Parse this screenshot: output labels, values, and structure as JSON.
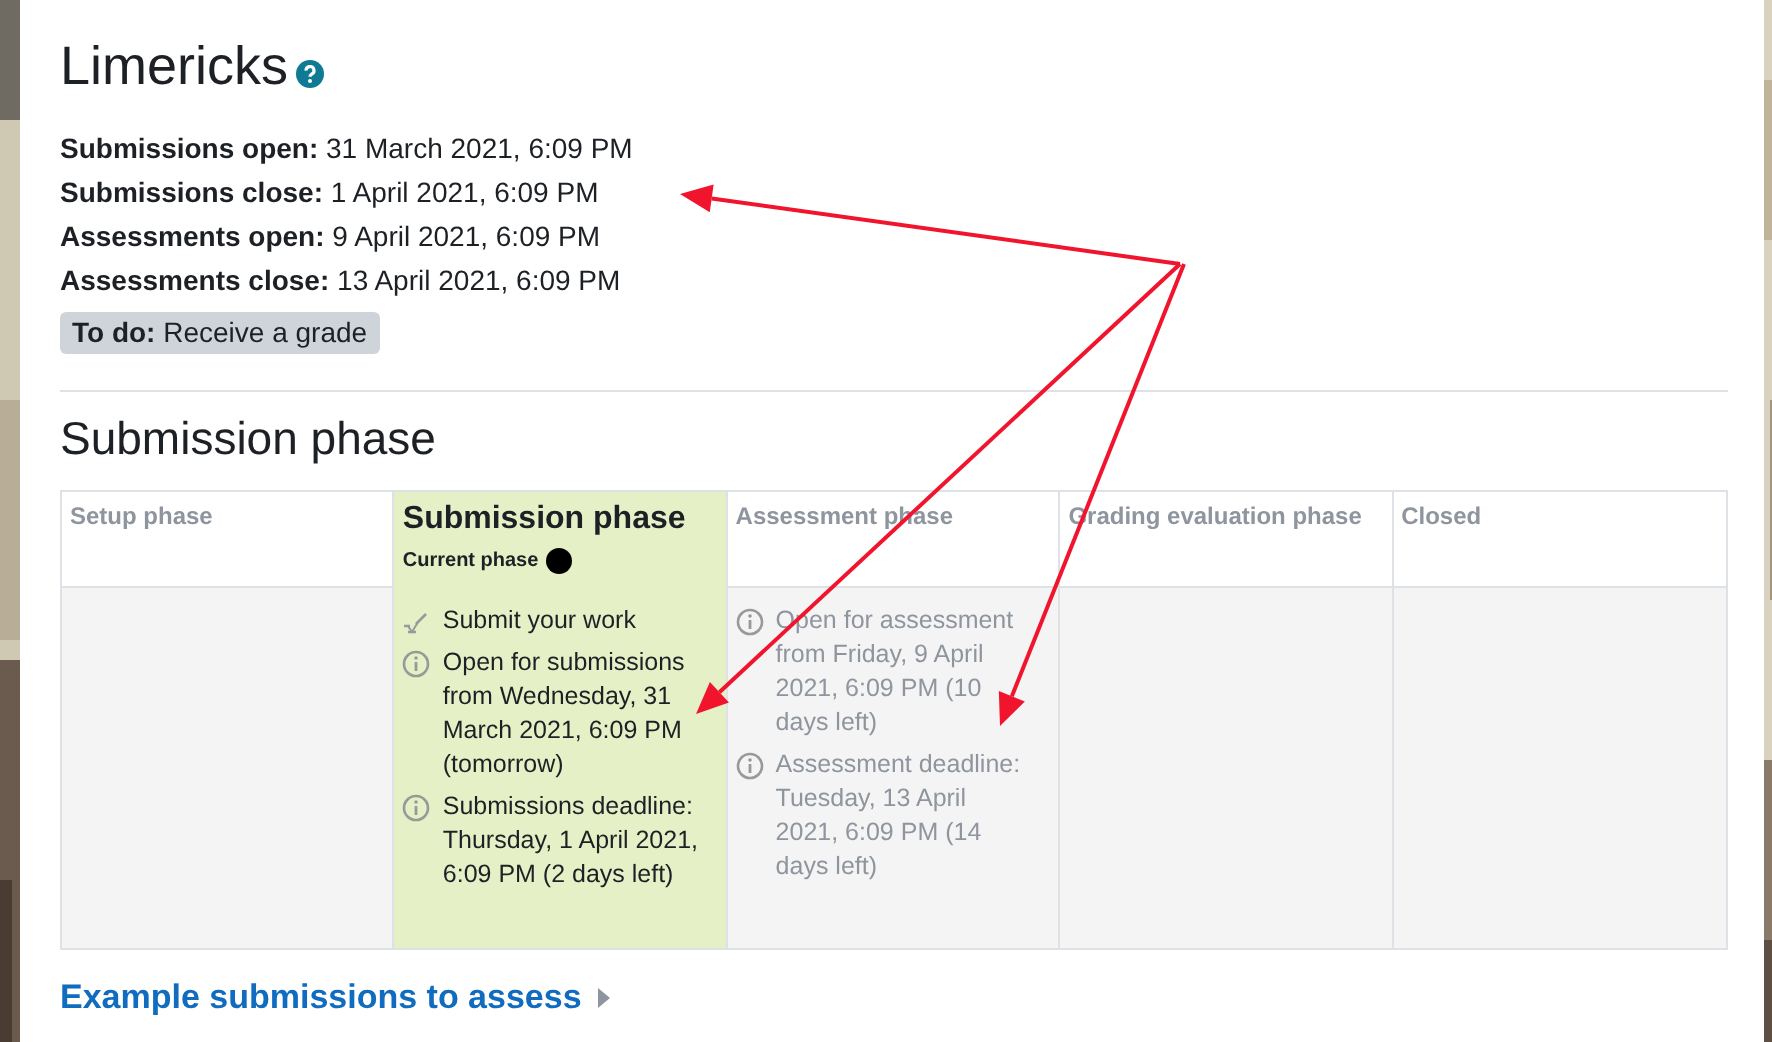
{
  "title": "Limericks",
  "dates": [
    {
      "label": "Submissions open:",
      "value": "31 March 2021, 6:09 PM"
    },
    {
      "label": "Submissions close:",
      "value": "1 April 2021, 6:09 PM"
    },
    {
      "label": "Assessments open:",
      "value": "9 April 2021, 6:09 PM"
    },
    {
      "label": "Assessments close:",
      "value": "13 April 2021, 6:09 PM"
    }
  ],
  "todo": {
    "label": "To do:",
    "value": "Receive a grade"
  },
  "section_title": "Submission phase",
  "phases": [
    {
      "title": "Setup phase",
      "selected": false
    },
    {
      "title": "Submission phase",
      "selected": true,
      "status_label": "Current phase",
      "tasks": [
        {
          "kind": "todo",
          "text": "Submit your work"
        },
        {
          "kind": "info",
          "text": "Open for submissions from Wednesday, 31 March 2021, 6:09 PM (tomorrow)"
        },
        {
          "kind": "info",
          "text": "Submissions deadline: Thursday, 1 April 2021, 6:09 PM (2 days left)"
        }
      ]
    },
    {
      "title": "Assessment phase",
      "selected": false,
      "tasks": [
        {
          "kind": "info",
          "text": "Open for assessment from Friday, 9 April 2021, 6:09 PM (10 days left)"
        },
        {
          "kind": "info",
          "text": "Assessment deadline: Tuesday, 13 April 2021, 6:09 PM (14 days left)"
        }
      ]
    },
    {
      "title": "Grading evaluation phase",
      "selected": false
    },
    {
      "title": "Closed",
      "selected": false
    }
  ],
  "link": "Example submissions to assess"
}
